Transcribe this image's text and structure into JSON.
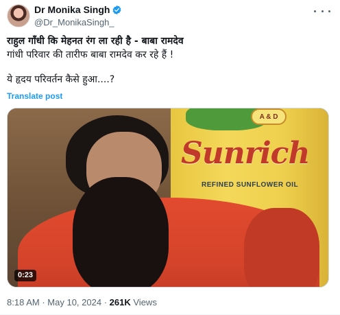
{
  "author": {
    "name": "Dr Monika Singh",
    "handle": "@Dr_MonikaSingh_",
    "verified_color": "#1d9bf0"
  },
  "tweet": {
    "line1": "राहुल गाँधी कि मेहनत रंग ला रही है - बाबा रामदेव",
    "line2": "गांधी परिवार की तारीफ बाबा रामदेव कर रहे हैं !",
    "line3": "ये हृदय परिवर्तन कैसे हुआ....?",
    "translate_label": "Translate post"
  },
  "media": {
    "brand_text": "Sunrich",
    "brand_subtext": "REFINED SUNFLOWER OIL",
    "badge_text": "A & D",
    "duration": "0:23"
  },
  "meta": {
    "time": "8:18 AM",
    "separator": "·",
    "date": "May 10, 2024",
    "views_count": "261K",
    "views_label": "Views"
  },
  "icons": {
    "verified": "verified-badge-icon",
    "more": "more-options-icon"
  }
}
